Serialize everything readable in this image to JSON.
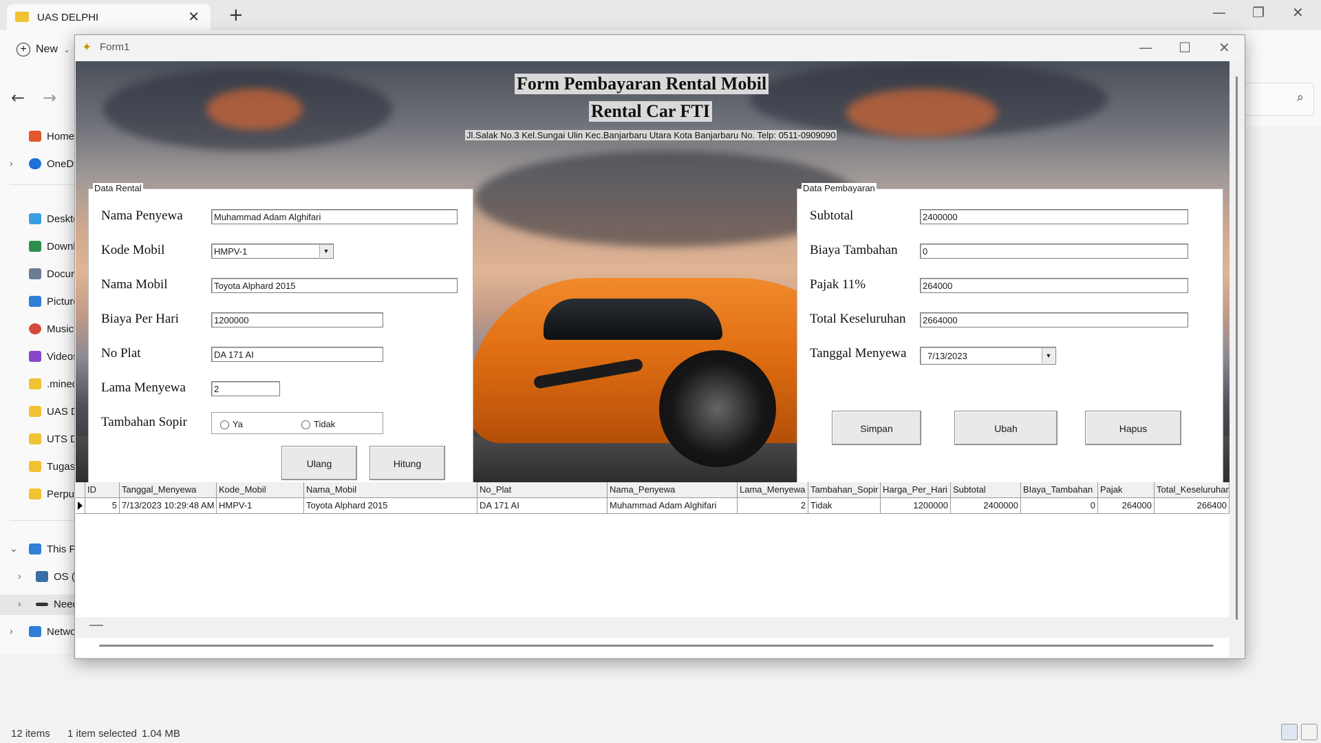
{
  "explorer": {
    "tab_title": "UAS DELPHI",
    "toolbar_new": "New",
    "sidebar": [
      {
        "label": "Home",
        "icon": "home-icon",
        "color": "#e2572b"
      },
      {
        "label": "OneDrive",
        "icon": "cloud-icon",
        "color": "#1e6fd9"
      },
      {
        "label": "Desktop",
        "icon": "desktop-icon",
        "color": "#3a9fe0"
      },
      {
        "label": "Downloads",
        "icon": "download-icon",
        "color": "#2d8d4b"
      },
      {
        "label": "Documents",
        "icon": "document-icon",
        "color": "#6b7c93"
      },
      {
        "label": "Pictures",
        "icon": "pictures-icon",
        "color": "#2f7fd6"
      },
      {
        "label": "Music",
        "icon": "music-icon",
        "color": "#d6493a"
      },
      {
        "label": "Videos",
        "icon": "videos-icon",
        "color": "#8a46c9"
      },
      {
        "label": ".minecraft",
        "icon": "folder-icon",
        "color": "#f1c232"
      },
      {
        "label": "UAS DELPHI",
        "icon": "folder-icon",
        "color": "#f1c232"
      },
      {
        "label": "UTS DELPHI",
        "icon": "folder-icon",
        "color": "#f1c232"
      },
      {
        "label": "Tugas",
        "icon": "folder-icon",
        "color": "#f1c232"
      },
      {
        "label": "Perpustakaan",
        "icon": "folder-icon",
        "color": "#f1c232"
      },
      {
        "label": "This PC",
        "icon": "pc-icon",
        "color": "#2f7fd6"
      },
      {
        "label": "OS (C:)",
        "icon": "drive-icon",
        "color": "#3a6ea5"
      },
      {
        "label": "Need",
        "icon": "drive-icon",
        "color": "#333333"
      },
      {
        "label": "Network",
        "icon": "network-icon",
        "color": "#2f7fd6"
      }
    ],
    "status": {
      "items": "12 items",
      "selected": "1 item selected",
      "size": "1.04 MB"
    }
  },
  "form": {
    "title": "Form1",
    "header_title": "Form Pembayaran Rental Mobil",
    "header_subtitle": "Rental Car FTI",
    "address": "Jl.Salak No.3 Kel.Sungai Ulin Kec.Banjarbaru Utara Kota Banjarbaru No. Telp: 0511-0909090",
    "data_rental": {
      "group_title": "Data Rental",
      "nama_penyewa_label": "Nama Penyewa",
      "nama_penyewa_value": "Muhammad Adam Alghifari",
      "kode_mobil_label": "Kode Mobil",
      "kode_mobil_value": "HMPV-1",
      "nama_mobil_label": "Nama Mobil",
      "nama_mobil_value": "Toyota Alphard 2015",
      "biaya_per_hari_label": "Biaya Per Hari",
      "biaya_per_hari_value": "1200000",
      "no_plat_label": "No Plat",
      "no_plat_value": "DA 171 AI",
      "lama_menyewa_label": "Lama Menyewa",
      "lama_menyewa_value": "2",
      "tambahan_sopir_label": "Tambahan Sopir",
      "opt_ya": "Ya",
      "opt_tidak": "Tidak",
      "btn_ulang": "Ulang",
      "btn_hitung": "Hitung"
    },
    "data_pembayaran": {
      "group_title": "Data Pembayaran",
      "subtotal_label": "Subtotal",
      "subtotal_value": "2400000",
      "biaya_tambahan_label": "Biaya Tambahan",
      "biaya_tambahan_value": "0",
      "pajak_label": "Pajak 11%",
      "pajak_value": "264000",
      "total_label": "Total Keseluruhan",
      "total_value": "2664000",
      "tanggal_label": "Tanggal Menyewa",
      "tanggal_value": "7/13/2023",
      "btn_simpan": "Simpan",
      "btn_ubah": "Ubah",
      "btn_hapus": "Hapus"
    },
    "grid": {
      "columns": [
        "ID",
        "Tanggal_Menyewa",
        "Kode_Mobil",
        "Nama_Mobil",
        "No_Plat",
        "Nama_Penyewa",
        "Lama_Menyewa",
        "Tambahan_Sopir",
        "Harga_Per_Hari",
        "Subtotal",
        "BIaya_Tambahan",
        "Pajak",
        "Total_Keseluruhan"
      ],
      "rows": [
        [
          "5",
          "7/13/2023 10:29:48 AM",
          "HMPV-1",
          "Toyota Alphard 2015",
          "DA 171 AI",
          "Muhammad Adam Alghifari",
          "2",
          "Tidak",
          "1200000",
          "2400000",
          "0",
          "264000",
          "266400"
        ]
      ]
    }
  }
}
